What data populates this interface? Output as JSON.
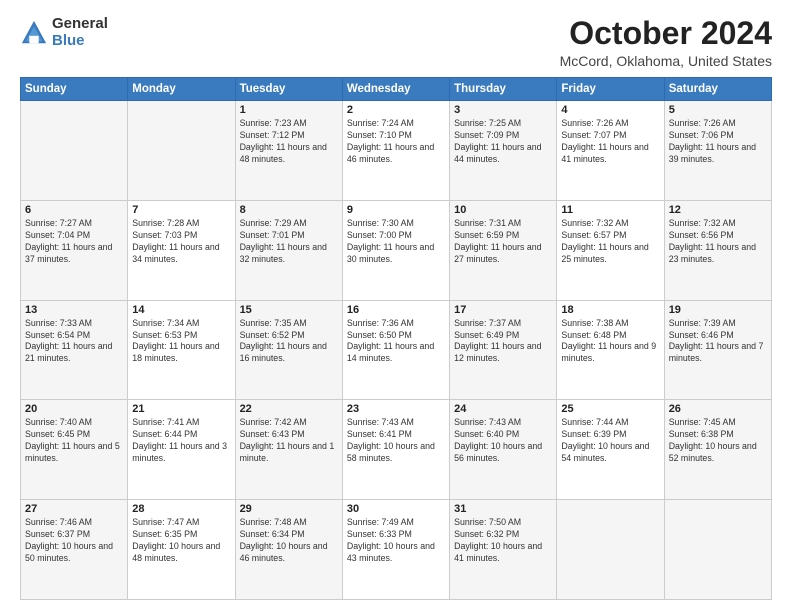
{
  "logo": {
    "general": "General",
    "blue": "Blue"
  },
  "title": {
    "month": "October 2024",
    "location": "McCord, Oklahoma, United States"
  },
  "days_of_week": [
    "Sunday",
    "Monday",
    "Tuesday",
    "Wednesday",
    "Thursday",
    "Friday",
    "Saturday"
  ],
  "weeks": [
    [
      {
        "day": "",
        "info": ""
      },
      {
        "day": "",
        "info": ""
      },
      {
        "day": "1",
        "info": "Sunrise: 7:23 AM\nSunset: 7:12 PM\nDaylight: 11 hours and 48 minutes."
      },
      {
        "day": "2",
        "info": "Sunrise: 7:24 AM\nSunset: 7:10 PM\nDaylight: 11 hours and 46 minutes."
      },
      {
        "day": "3",
        "info": "Sunrise: 7:25 AM\nSunset: 7:09 PM\nDaylight: 11 hours and 44 minutes."
      },
      {
        "day": "4",
        "info": "Sunrise: 7:26 AM\nSunset: 7:07 PM\nDaylight: 11 hours and 41 minutes."
      },
      {
        "day": "5",
        "info": "Sunrise: 7:26 AM\nSunset: 7:06 PM\nDaylight: 11 hours and 39 minutes."
      }
    ],
    [
      {
        "day": "6",
        "info": "Sunrise: 7:27 AM\nSunset: 7:04 PM\nDaylight: 11 hours and 37 minutes."
      },
      {
        "day": "7",
        "info": "Sunrise: 7:28 AM\nSunset: 7:03 PM\nDaylight: 11 hours and 34 minutes."
      },
      {
        "day": "8",
        "info": "Sunrise: 7:29 AM\nSunset: 7:01 PM\nDaylight: 11 hours and 32 minutes."
      },
      {
        "day": "9",
        "info": "Sunrise: 7:30 AM\nSunset: 7:00 PM\nDaylight: 11 hours and 30 minutes."
      },
      {
        "day": "10",
        "info": "Sunrise: 7:31 AM\nSunset: 6:59 PM\nDaylight: 11 hours and 27 minutes."
      },
      {
        "day": "11",
        "info": "Sunrise: 7:32 AM\nSunset: 6:57 PM\nDaylight: 11 hours and 25 minutes."
      },
      {
        "day": "12",
        "info": "Sunrise: 7:32 AM\nSunset: 6:56 PM\nDaylight: 11 hours and 23 minutes."
      }
    ],
    [
      {
        "day": "13",
        "info": "Sunrise: 7:33 AM\nSunset: 6:54 PM\nDaylight: 11 hours and 21 minutes."
      },
      {
        "day": "14",
        "info": "Sunrise: 7:34 AM\nSunset: 6:53 PM\nDaylight: 11 hours and 18 minutes."
      },
      {
        "day": "15",
        "info": "Sunrise: 7:35 AM\nSunset: 6:52 PM\nDaylight: 11 hours and 16 minutes."
      },
      {
        "day": "16",
        "info": "Sunrise: 7:36 AM\nSunset: 6:50 PM\nDaylight: 11 hours and 14 minutes."
      },
      {
        "day": "17",
        "info": "Sunrise: 7:37 AM\nSunset: 6:49 PM\nDaylight: 11 hours and 12 minutes."
      },
      {
        "day": "18",
        "info": "Sunrise: 7:38 AM\nSunset: 6:48 PM\nDaylight: 11 hours and 9 minutes."
      },
      {
        "day": "19",
        "info": "Sunrise: 7:39 AM\nSunset: 6:46 PM\nDaylight: 11 hours and 7 minutes."
      }
    ],
    [
      {
        "day": "20",
        "info": "Sunrise: 7:40 AM\nSunset: 6:45 PM\nDaylight: 11 hours and 5 minutes."
      },
      {
        "day": "21",
        "info": "Sunrise: 7:41 AM\nSunset: 6:44 PM\nDaylight: 11 hours and 3 minutes."
      },
      {
        "day": "22",
        "info": "Sunrise: 7:42 AM\nSunset: 6:43 PM\nDaylight: 11 hours and 1 minute."
      },
      {
        "day": "23",
        "info": "Sunrise: 7:43 AM\nSunset: 6:41 PM\nDaylight: 10 hours and 58 minutes."
      },
      {
        "day": "24",
        "info": "Sunrise: 7:43 AM\nSunset: 6:40 PM\nDaylight: 10 hours and 56 minutes."
      },
      {
        "day": "25",
        "info": "Sunrise: 7:44 AM\nSunset: 6:39 PM\nDaylight: 10 hours and 54 minutes."
      },
      {
        "day": "26",
        "info": "Sunrise: 7:45 AM\nSunset: 6:38 PM\nDaylight: 10 hours and 52 minutes."
      }
    ],
    [
      {
        "day": "27",
        "info": "Sunrise: 7:46 AM\nSunset: 6:37 PM\nDaylight: 10 hours and 50 minutes."
      },
      {
        "day": "28",
        "info": "Sunrise: 7:47 AM\nSunset: 6:35 PM\nDaylight: 10 hours and 48 minutes."
      },
      {
        "day": "29",
        "info": "Sunrise: 7:48 AM\nSunset: 6:34 PM\nDaylight: 10 hours and 46 minutes."
      },
      {
        "day": "30",
        "info": "Sunrise: 7:49 AM\nSunset: 6:33 PM\nDaylight: 10 hours and 43 minutes."
      },
      {
        "day": "31",
        "info": "Sunrise: 7:50 AM\nSunset: 6:32 PM\nDaylight: 10 hours and 41 minutes."
      },
      {
        "day": "",
        "info": ""
      },
      {
        "day": "",
        "info": ""
      }
    ]
  ]
}
